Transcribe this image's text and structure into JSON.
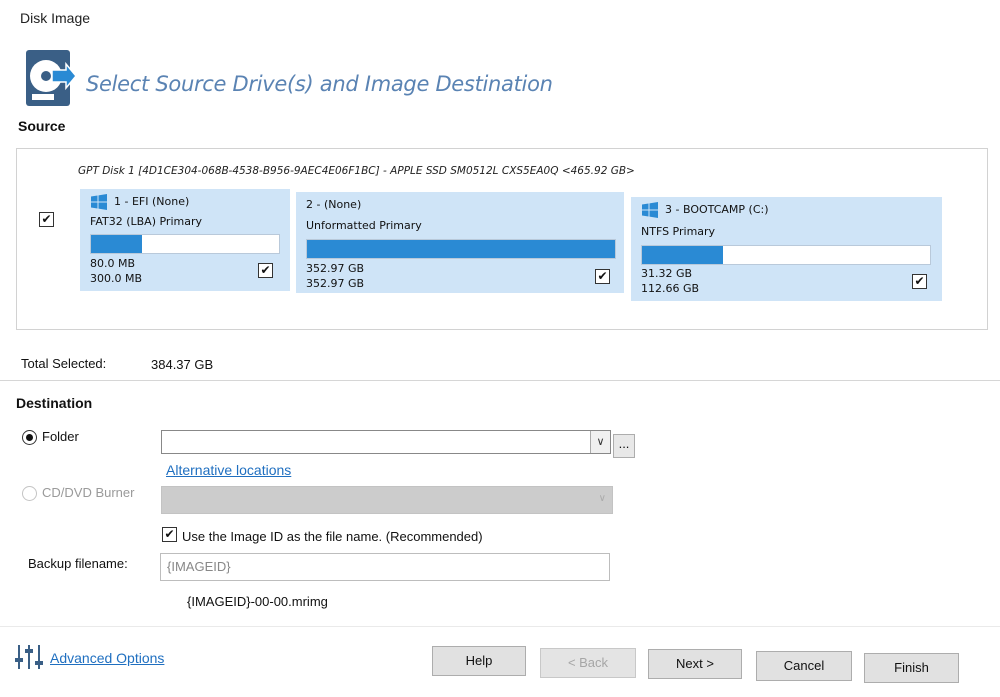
{
  "window": {
    "title": "Disk Image"
  },
  "header": {
    "title": "Select Source Drive(s) and Image Destination"
  },
  "source": {
    "label": "Source",
    "disk": {
      "label": "GPT Disk 1 [4D1CE304-068B-4538-B956-9AEC4E06F1BC] - APPLE SSD SM0512L CXS5EA0Q  <465.92 GB>",
      "checked": true,
      "partitions": [
        {
          "name": "1 - EFI (None)",
          "type": "FAT32 (LBA) Primary",
          "used": "80.0 MB",
          "total": "300.0 MB",
          "fill_fraction": 0.27,
          "checked": true,
          "icon": "windows-logo-icon"
        },
        {
          "name": "2 -  (None)",
          "type": "Unformatted Primary",
          "used": "352.97 GB",
          "total": "352.97 GB",
          "fill_fraction": 1.0,
          "checked": true,
          "icon": ""
        },
        {
          "name": "3 - BOOTCAMP (C:)",
          "type": "NTFS Primary",
          "used": "31.32 GB",
          "total": "112.66 GB",
          "fill_fraction": 0.28,
          "checked": true,
          "icon": "windows-logo-icon"
        }
      ]
    },
    "total_selected_label": "Total Selected:",
    "total_selected_value": "384.37 GB"
  },
  "destination": {
    "label": "Destination",
    "folder_label": "Folder",
    "folder_value": "",
    "folder_browse": "...",
    "alt_locations": "Alternative locations",
    "cd_label": "CD/DVD Burner",
    "use_image_id_label": "Use the Image ID as the file name.  (Recommended)",
    "use_image_id_checked": true,
    "backup_filename_label": "Backup filename:",
    "backup_filename_placeholder": "{IMAGEID}",
    "filename_preview": "{IMAGEID}-00-00.mrimg"
  },
  "footer": {
    "advanced_options": "Advanced Options",
    "help": "Help",
    "back": "< Back",
    "next": "Next >",
    "cancel": "Cancel",
    "finish": "Finish"
  },
  "colors": {
    "accent": "#2a8ad4",
    "partition_bg": "#cfe4f7",
    "header_title": "#5a83b3",
    "link": "#1f6fc0"
  }
}
